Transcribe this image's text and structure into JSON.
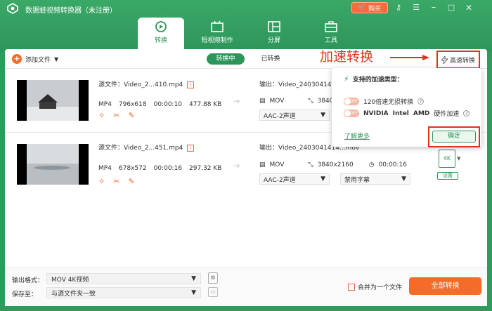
{
  "app": {
    "title": "数据蛙视频转换器（未注册）",
    "buy_label": "购买"
  },
  "tabs": [
    {
      "label": "转换"
    },
    {
      "label": "短视频制作"
    },
    {
      "label": "分屏"
    },
    {
      "label": "工具"
    }
  ],
  "toolbar": {
    "add_label": "添加文件",
    "seg_converting": "转换中",
    "seg_converted": "已转换",
    "speed_label": "高速转换",
    "annotation": "加速转换"
  },
  "files": [
    {
      "source": "源文件：Video_2...410.mp4",
      "format": "MP4",
      "resolution": "796x618",
      "duration": "00:00:10",
      "size": "477.88 KB",
      "output": "输出：Video_2403041414",
      "out_format": "MOV",
      "out_resolution": "3840",
      "audio": "AAC-2声道"
    },
    {
      "source": "源文件：Video_2...451.mp4",
      "format": "MP4",
      "resolution": "678x572",
      "duration": "00:00:16",
      "size": "297.32 KB",
      "output": "输出：Video_2403041414...mov",
      "out_format": "MOV",
      "out_resolution": "3840x2160",
      "out_duration": "00:00:16",
      "audio": "AAC-2声道",
      "subtitle": "禁用字幕",
      "settings_label": "设置"
    }
  ],
  "popup": {
    "title": "支持的加速类型：",
    "toggle_label": "OFF",
    "option1": "120倍速无损转换",
    "option2_nvidia": "NVIDIA",
    "option2_intel": "Intel",
    "option2_amd": "AMD",
    "option2_suffix": "硬件加速",
    "learn_more": "了解更多",
    "confirm": "确定"
  },
  "bottom": {
    "format_label": "输出格式：",
    "format_value": "MOV 4K视频",
    "save_label": "保存至：",
    "save_value": "与源文件夹一致",
    "merge_label": "合并为一个文件",
    "convert_all": "全部转换"
  },
  "colors": {
    "brand_green": "#2e955a",
    "accent_orange": "#f56b2a",
    "annotation_red": "#e0321c"
  }
}
